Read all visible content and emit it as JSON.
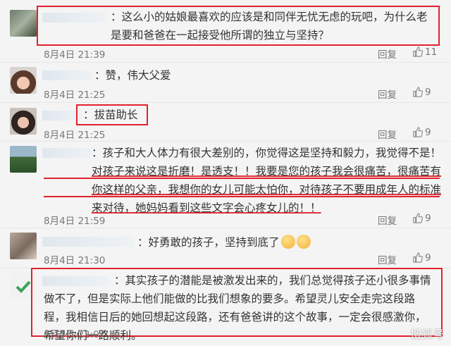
{
  "reply_label": "回复",
  "comments": [
    {
      "text": "：这么小的姑娘最喜欢的应该是和同伴无忧无虑的玩吧，为什么老是要和爸爸在一起接受他所谓的独立与坚持？",
      "time": "8月4日 21:39",
      "likes": "11"
    },
    {
      "text": "：赞，伟大父爱",
      "time": "8月4日 21:25",
      "likes": "9"
    },
    {
      "text": "：拔苗助长",
      "time": "8月4日 21:25",
      "likes": "9"
    },
    {
      "text_parts": [
        "：孩子和大人体力有很大差别的，你觉得这是坚持和毅力，我觉得不是！",
        "对孩子来说这是折磨！是透支！！我要是您的孩子我会很痛苦，很痛苦有你这样的父亲，我想你的女儿可能太怕你，对待孩子不要用成年人的标准来对待，她妈妈看到这些文字会心疼女儿的！！"
      ],
      "time": "8月4日 21:59",
      "likes": "9"
    },
    {
      "text": "：好勇敢的孩子，坚持到底了",
      "time": "8月4日 21:30",
      "likes": "9"
    },
    {
      "text": "：其实孩子的潜能是被激发出来的，我们总觉得孩子还小很多事情做不了，但是实际上他们能做的比我们想象的要多。希望灵儿安全走完这段路程，我相信日后的她回想起这段路，还有爸爸讲的这个故事，一定会很感激你，希望你们一路顺利。",
      "time": "8月4日 22:07",
      "likes": ""
    }
  ],
  "watermark": "搜狐号"
}
